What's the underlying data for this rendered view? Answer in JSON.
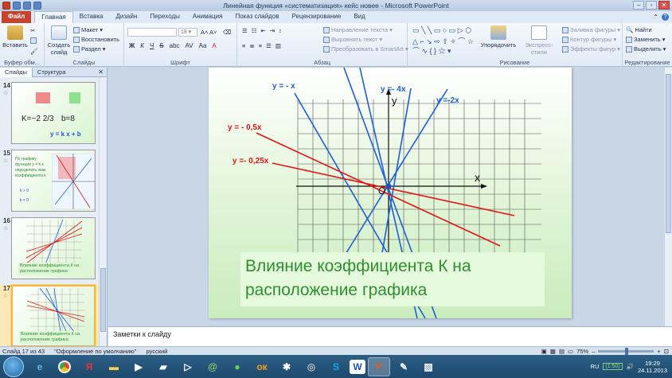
{
  "window": {
    "title": "Линейная функция «систематизация» кейс новее - Microsoft PowerPoint"
  },
  "tabs": [
    "Файл",
    "Главная",
    "Вставка",
    "Дизайн",
    "Переходы",
    "Анимация",
    "Показ слайдов",
    "Рецензирование",
    "Вид"
  ],
  "ribbon": {
    "clipboard": {
      "paste": "Вставить",
      "label": "Буфер обм..."
    },
    "slides": {
      "create": "Создать слайд",
      "layout": "Макет",
      "reset": "Восстановить",
      "section": "Раздел",
      "label": "Слайды"
    },
    "font": {
      "size": "18",
      "label": "Шрифт"
    },
    "paragraph": {
      "direction": "Направление текста",
      "align": "Выровнять текст",
      "smartart": "Преобразовать в SmartArt",
      "label": "Абзац"
    },
    "drawing": {
      "arrange": "Упорядочить",
      "styles": "Экспресс-стили",
      "fill": "Заливка фигуры",
      "outline": "Контур фигуры",
      "effects": "Эффекты фигур",
      "label": "Рисование"
    },
    "editing": {
      "find": "Найти",
      "replace": "Заменить",
      "select": "Выделить",
      "label": "Редактирование"
    }
  },
  "panel": {
    "tab_slides": "Слайды",
    "tab_structure": "Структура"
  },
  "thumbnails": [
    {
      "num": "14",
      "lines": [
        "K=−2 2/3",
        "b=8",
        "y = k x + b"
      ]
    },
    {
      "num": "15",
      "lines": [
        "По графику функции y = k x определить знак коэффициента  k",
        "k > 0",
        "k < 0"
      ]
    },
    {
      "num": "16",
      "caption": "Влияние коэффициента К на расположение графика"
    },
    {
      "num": "17",
      "caption": "Влияние коэффициента К на расположение графика"
    }
  ],
  "slide": {
    "title": "Влияние коэффициента К на расположение графика",
    "axis_x": "x",
    "axis_y": "y",
    "origin": "O",
    "labels": {
      "neg_x": "y = - x",
      "neg_4x": "y =- 4x",
      "neg_2x": "y =-2x",
      "neg_05x": "y = - 0,5x",
      "neg_025x": "y =- 0,25x"
    },
    "colors": {
      "blue": "#1f5fd6",
      "red": "#e01515"
    }
  },
  "notes": {
    "placeholder": "Заметки к слайду"
  },
  "status": {
    "slide": "Слайд 17 из 43",
    "theme": "\"Оформление по умолчанию\"",
    "lang": "русский",
    "zoom": "75%"
  },
  "taskbar": {
    "lang": "RU",
    "timer": "(1:50)",
    "time": "19:29",
    "date": "24.11.2013"
  }
}
